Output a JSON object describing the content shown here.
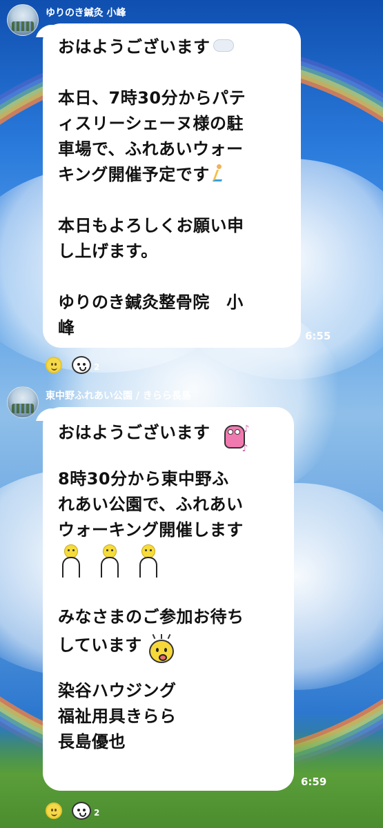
{
  "messages": [
    {
      "sender": "ゆりのき鍼灸 小峰",
      "lines": {
        "l1": "おはようございます",
        "l2": "本日、7時30分からパテ",
        "l3": "ィスリーシェーヌ様の駐",
        "l4": "車場で、ふれあいウォー",
        "l5": "キング開催予定です",
        "l6": "本日もよろしくお願い申",
        "l7": "し上げます。",
        "l8": "ゆりのき鍼灸整骨院　小",
        "l9": "峰"
      },
      "time": "6:55",
      "reaction_count": "2",
      "emoji": [
        "cloud-emoji",
        "runner-emoji"
      ]
    },
    {
      "sender": "東中野ふれあい公園 / きらら長島",
      "lines": {
        "l1": "おはようございます",
        "l2": "8時30分から東中野ふ",
        "l3": "れあい公園で、ふれあい",
        "l4": "ウォーキング開催します",
        "l5": "みなさまのご参加お待ち",
        "l6": "しています",
        "l7": "染谷ハウジング",
        "l8": "福祉用具きらら",
        "l9": "長島優也"
      },
      "time": "6:59",
      "reaction_count": "2",
      "emoji": [
        "dino-sticker",
        "yellow-dude-sticker",
        "surprised-face-sticker"
      ]
    }
  ],
  "colors": {
    "bubble": "#ffffff",
    "text": "#111111",
    "name_and_time": "#ffffff",
    "sky_top": "#0f4fb0",
    "grass": "#4b8c2e"
  }
}
